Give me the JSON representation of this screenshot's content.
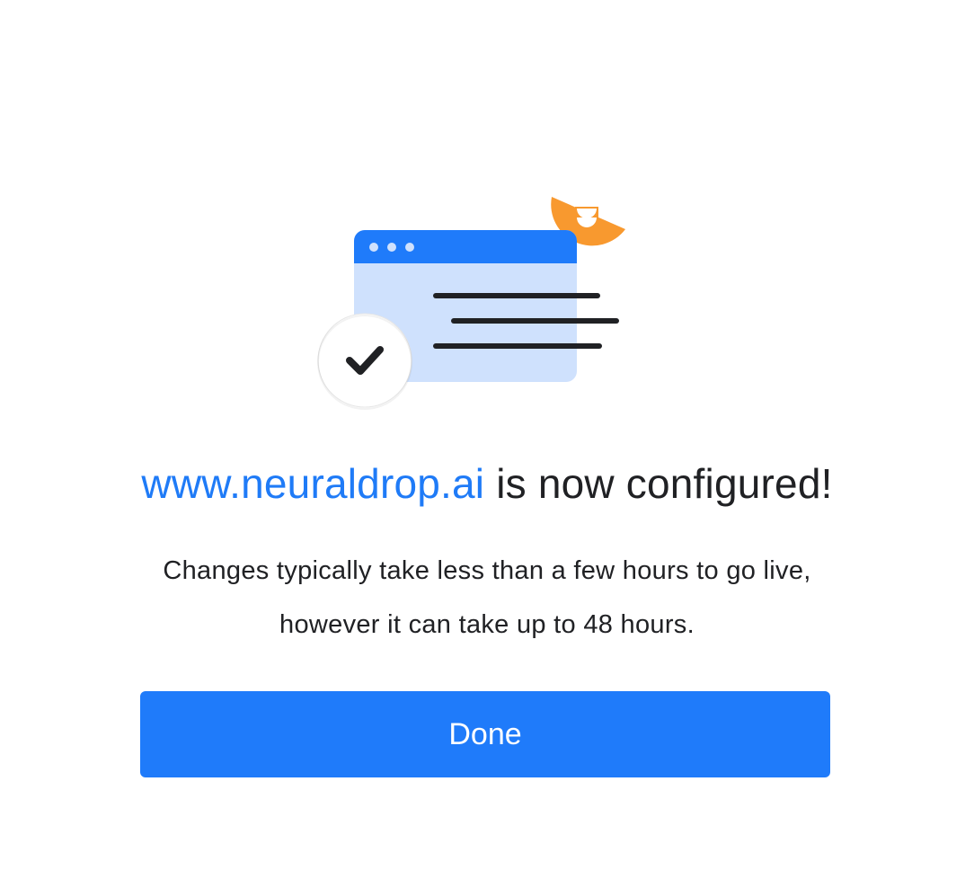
{
  "dialog": {
    "domain_text": "www.neuraldrop.ai",
    "headline_suffix": " is now configured!",
    "body_text": "Changes typically take less than a few hours to go live, however it can take up to 48 hours.",
    "done_label": "Done"
  },
  "colors": {
    "accent": "#1f7bfa",
    "browser_body": "#cfe1fd",
    "orange_accent": "#f8992f",
    "text": "#202124"
  },
  "icons": [
    "browser-window-icon",
    "checkmark-icon",
    "orange-accent-shape"
  ]
}
